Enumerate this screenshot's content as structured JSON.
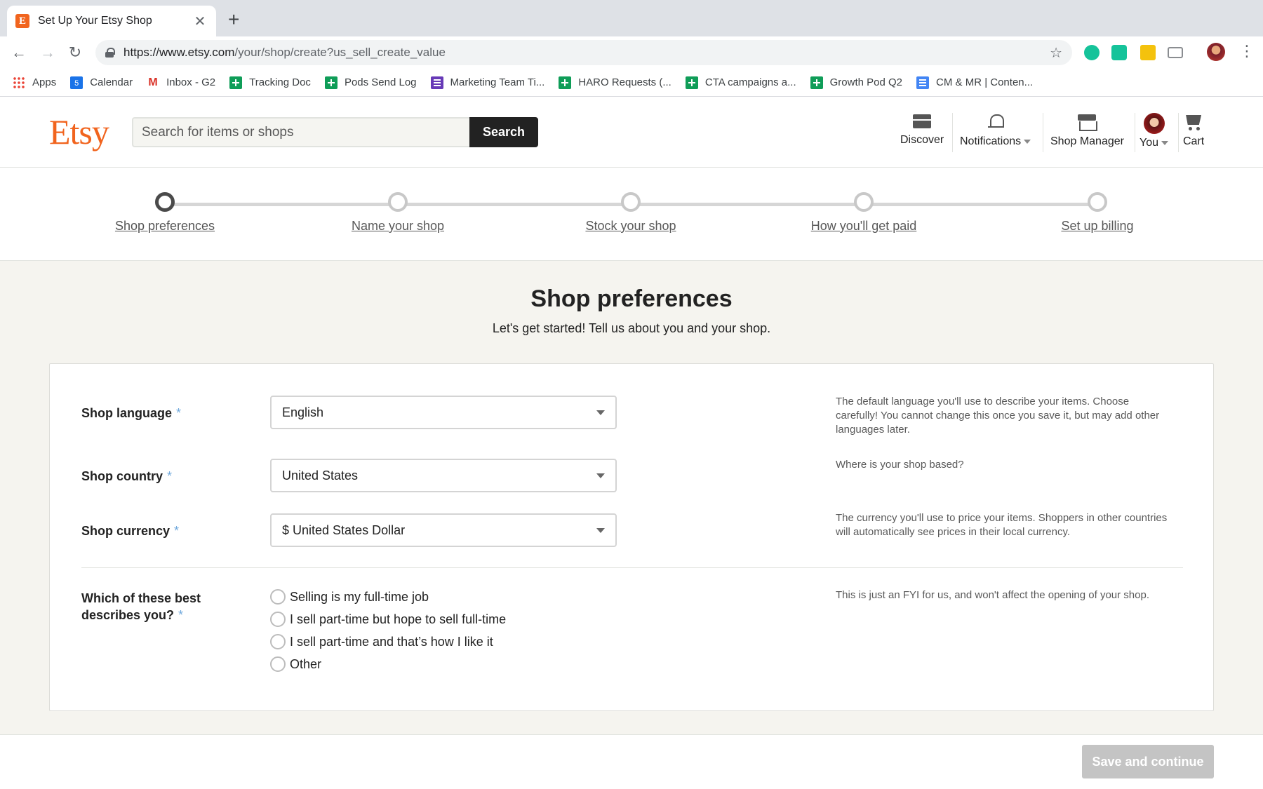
{
  "browser": {
    "tab_title": "Set Up Your Etsy Shop",
    "tab_favicon": "E",
    "url_host": "https://www.etsy.com",
    "url_path": "/your/shop/create?us_sell_create_value",
    "bookmarks": [
      {
        "label": "Apps",
        "icon": "apps-grid-icon"
      },
      {
        "label": "Calendar",
        "icon": "calendar-icon"
      },
      {
        "label": "Inbox - G2",
        "icon": "gmail-icon"
      },
      {
        "label": "Tracking Doc",
        "icon": "sheets-icon"
      },
      {
        "label": "Pods Send Log",
        "icon": "sheets-icon"
      },
      {
        "label": "Marketing Team Ti...",
        "icon": "forms-icon"
      },
      {
        "label": "HARO Requests (...",
        "icon": "sheets-icon"
      },
      {
        "label": "CTA campaigns a...",
        "icon": "sheets-icon"
      },
      {
        "label": "Growth Pod Q2",
        "icon": "sheets-icon"
      },
      {
        "label": "CM & MR | Conten...",
        "icon": "docs-icon"
      }
    ]
  },
  "header": {
    "logo": "Etsy",
    "search_placeholder": "Search for items or shops",
    "search_button": "Search",
    "nav": {
      "discover": "Discover",
      "notifications": "Notifications",
      "shop_manager": "Shop Manager",
      "you": "You",
      "cart": "Cart"
    }
  },
  "steps": [
    {
      "label": "Shop preferences",
      "active": true
    },
    {
      "label": "Name your shop",
      "active": false
    },
    {
      "label": "Stock your shop",
      "active": false
    },
    {
      "label": "How you'll get paid",
      "active": false
    },
    {
      "label": "Set up billing",
      "active": false
    }
  ],
  "page": {
    "title": "Shop preferences",
    "subtitle": "Let's get started! Tell us about you and your shop."
  },
  "form": {
    "required_marker": "*",
    "language": {
      "label": "Shop language",
      "value": "English",
      "help": "The default language you'll use to describe your items. Choose carefully! You cannot change this once you save it, but may add other languages later."
    },
    "country": {
      "label": "Shop country",
      "value": "United States",
      "help": "Where is your shop based?"
    },
    "currency": {
      "label": "Shop currency",
      "value": "$ United States Dollar",
      "help": "The currency you'll use to price your items. Shoppers in other countries will automatically see prices in their local currency."
    },
    "describes": {
      "label_line1": "Which of these best",
      "label_line2": "describes you?",
      "help": "This is just an FYI for us, and won't affect the opening of your shop.",
      "options": [
        "Selling is my full-time job",
        "I sell part-time but hope to sell full-time",
        "I sell part-time and that’s how I like it",
        "Other"
      ]
    }
  },
  "footer": {
    "save_button": "Save and continue"
  }
}
